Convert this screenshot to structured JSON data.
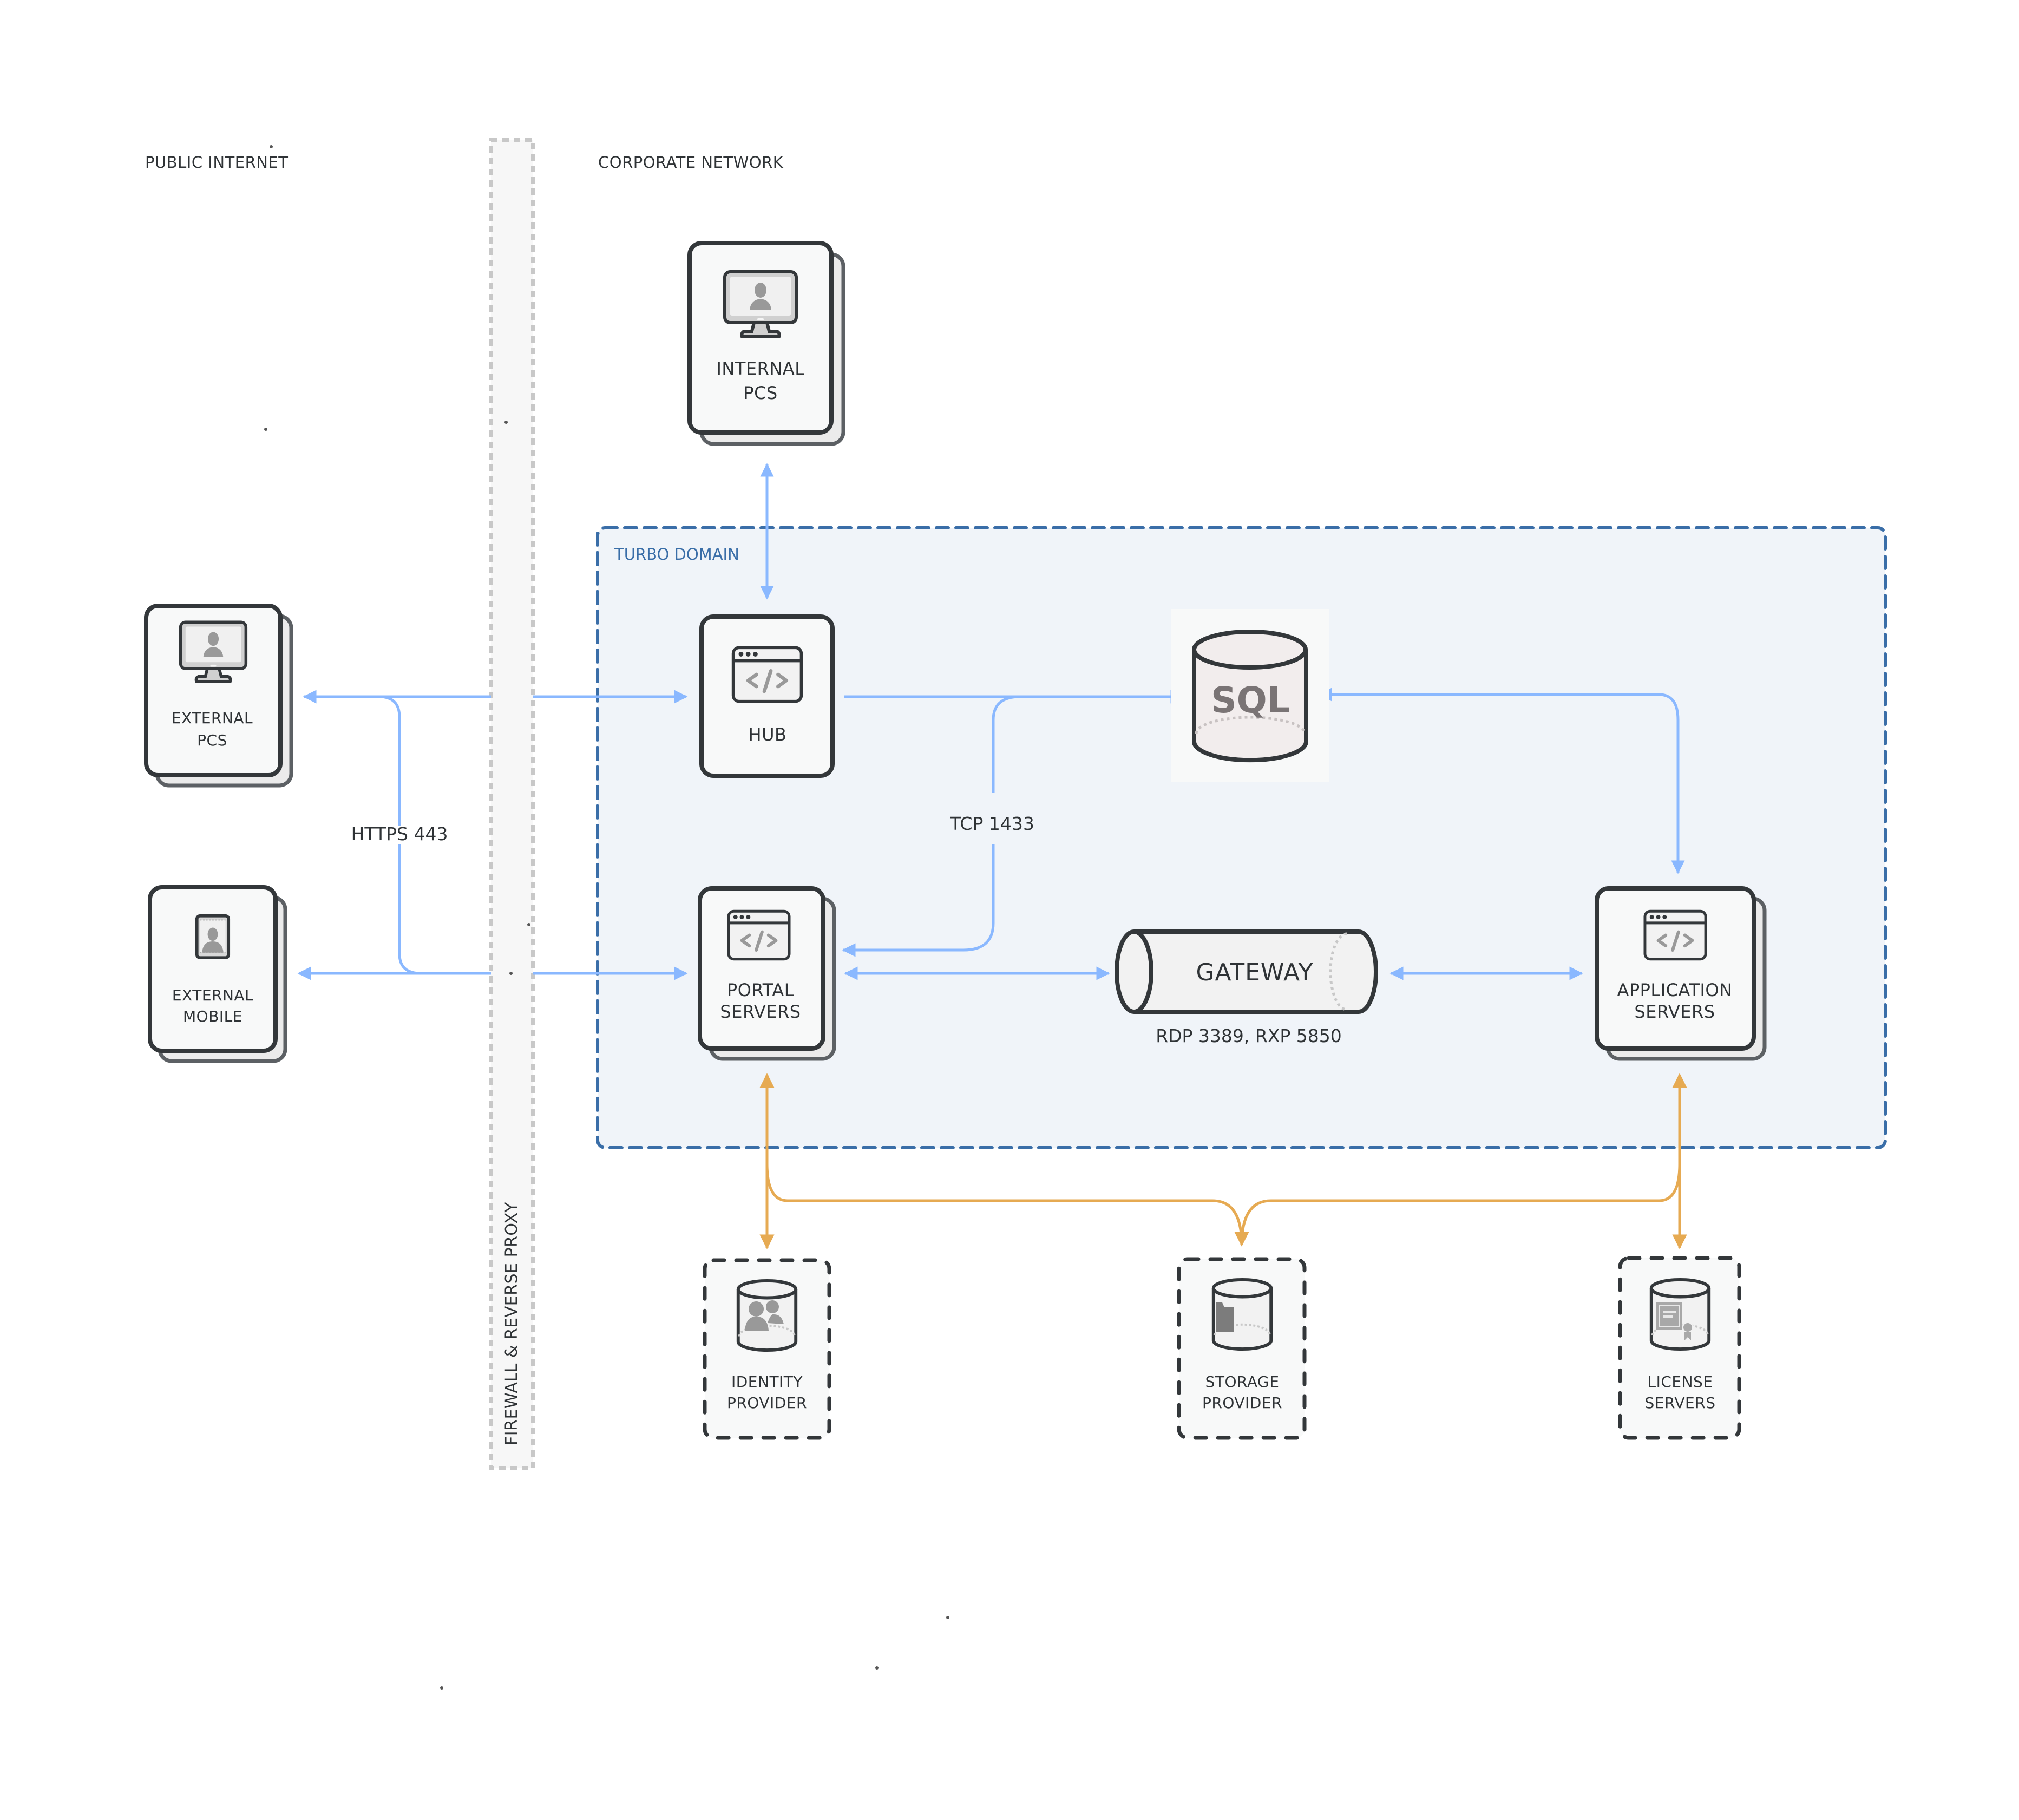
{
  "zones": {
    "public_internet": "PUBLIC INTERNET",
    "corporate_network": "CORPORATE NETWORK",
    "firewall": "FIREWALL & REVERSE PROXY",
    "turbo_domain": "TURBO DOMAIN"
  },
  "nodes": {
    "internal_pcs": {
      "line1": "INTERNAL",
      "line2": "PCS",
      "icon": "monitor-user-icon"
    },
    "external_pcs": {
      "line1": "EXTERNAL",
      "line2": "PCS",
      "icon": "monitor-user-icon"
    },
    "external_mobile": {
      "line1": "EXTERNAL",
      "line2": "MOBILE",
      "icon": "mobile-user-icon"
    },
    "hub": {
      "line1": "HUB",
      "icon": "code-window-icon"
    },
    "sql": {
      "label": "SQL",
      "icon": "database-icon"
    },
    "portal_servers": {
      "line1": "PORTAL",
      "line2": "SERVERS",
      "icon": "code-window-icon"
    },
    "gateway": {
      "label": "GATEWAY",
      "icon": "pipe-icon"
    },
    "application_servers": {
      "line1": "APPLICATION",
      "line2": "SERVERS",
      "icon": "code-window-icon"
    },
    "identity_provider": {
      "line1": "IDENTITY",
      "line2": "PROVIDER",
      "icon": "users-database-icon"
    },
    "storage_provider": {
      "line1": "STORAGE",
      "line2": "PROVIDER",
      "icon": "folder-database-icon"
    },
    "license_servers": {
      "line1": "LICENSE",
      "line2": "SERVERS",
      "icon": "certificate-database-icon"
    }
  },
  "connections": {
    "https": "HTTPS 443",
    "tcp": "TCP 1433",
    "gateway_ports": "RDP 3389, RXP 5850"
  },
  "colors": {
    "blue_connector": "#8ab8ff",
    "orange_connector": "#e6aa52",
    "domain_border": "#3a6ea8",
    "domain_fill": "#f0f4f9",
    "node_stroke": "#33373a",
    "firewall_border": "#c8c8c8"
  }
}
